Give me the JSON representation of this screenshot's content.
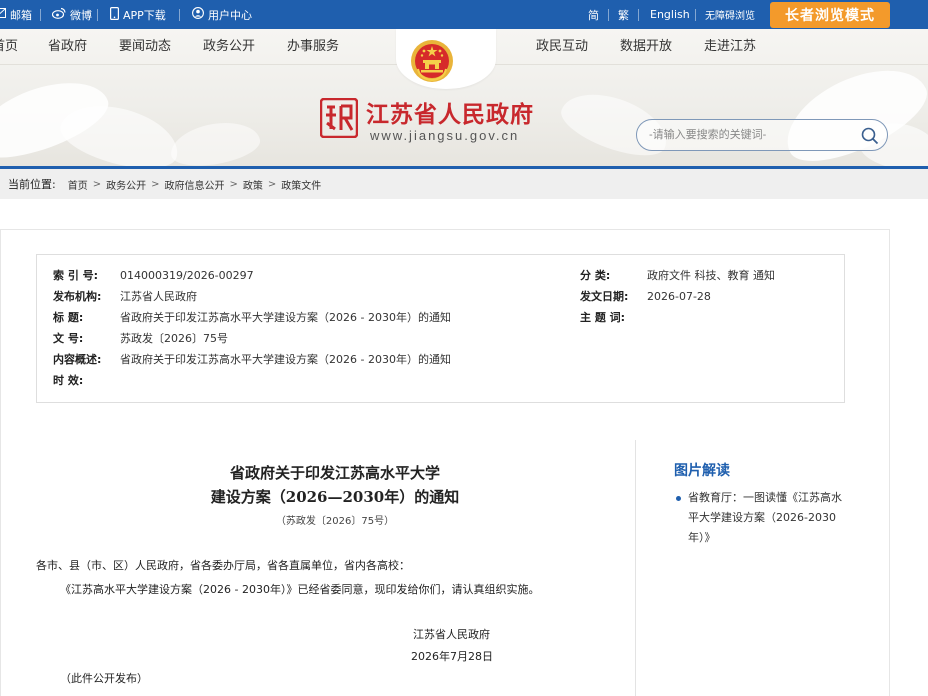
{
  "topbar": {
    "email": "邮箱",
    "weibo": "微博",
    "app": "APP下载",
    "user": "用户中心",
    "simplified": "简",
    "traditional": "繁",
    "english": "English",
    "accessible": "无障碍浏览",
    "elder_mode": "长者浏览模式"
  },
  "nav": {
    "items_left": [
      "首页",
      "省政府",
      "要闻动态",
      "政务公开",
      "办事服务"
    ],
    "items_right": [
      "政民互动",
      "数据开放",
      "走进江苏"
    ]
  },
  "site": {
    "name": "江苏省人民政府",
    "url": "www.jiangsu.gov.cn"
  },
  "search": {
    "placeholder": "-请输入要搜索的关键词-"
  },
  "breadcrumb": {
    "label": "当前位置:",
    "items": [
      "首页",
      "政务公开",
      "政府信息公开",
      "政策",
      "政策文件"
    ]
  },
  "meta": {
    "index_label": "索 引 号:",
    "index_value": "014000319/2026-00297",
    "org_label": "发布机构:",
    "org_value": "江苏省人民政府",
    "title_label": "标 题:",
    "title_value": "省政府关于印发江苏高水平大学建设方案（2026 - 2030年）的通知",
    "docno_label": "文 号:",
    "docno_value": "苏政发〔2026〕75号",
    "summary_label": "内容概述:",
    "summary_value": "省政府关于印发江苏高水平大学建设方案（2026 - 2030年）的通知",
    "validity_label": "时 效:",
    "validity_value": "",
    "category_label": "分 类:",
    "category_value": "政府文件 科技、教育 通知",
    "date_label": "发文日期:",
    "date_value": "2026-07-28",
    "subject_label": "主 题 词:",
    "subject_value": ""
  },
  "document": {
    "title_line1": "省政府关于印发江苏高水平大学",
    "title_line2": "建设方案（2026—2030年）的通知",
    "doc_number": "（苏政发〔2026〕75号）",
    "salutation": "各市、县（市、区）人民政府，省各委办厅局，省各直属单位，省内各高校：",
    "body": "《江苏高水平大学建设方案（2026 - 2030年）》已经省委同意，现印发给你们，请认真组织实施。",
    "signer": "江苏省人民政府",
    "sign_date": "2026年7月28日",
    "note": "（此件公开发布）"
  },
  "sidebar": {
    "title": "图片解读",
    "items": [
      "省教育厅：一图读懂《江苏高水平大学建设方案（2026-2030年）》"
    ]
  },
  "colors": {
    "brand_blue": "#1f5fae",
    "brand_red": "#c8282d",
    "elder_orange": "#f39a2b"
  }
}
